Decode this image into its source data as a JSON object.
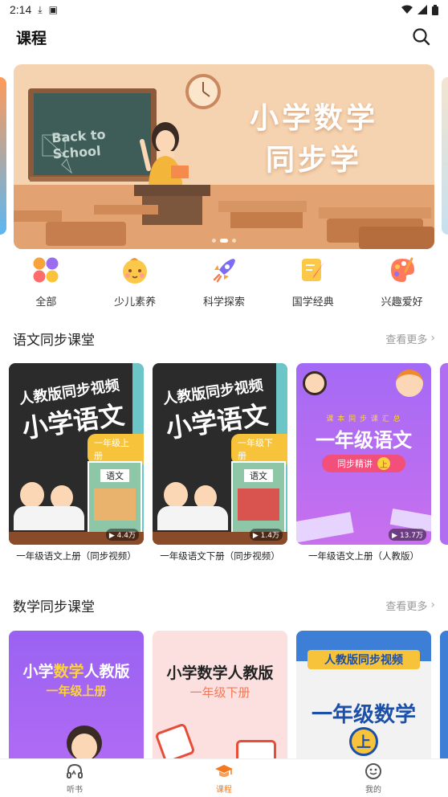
{
  "status_bar": {
    "time": "2:14"
  },
  "header": {
    "title": "课程"
  },
  "banner": {
    "title_line1": "小学数学",
    "title_line2": "同步学",
    "board_text1": "Back to",
    "board_text2": "School"
  },
  "categories": [
    {
      "label": "全部",
      "icon": "grid-icon"
    },
    {
      "label": "少儿素养",
      "icon": "baby-face-icon"
    },
    {
      "label": "科学探索",
      "icon": "rocket-icon"
    },
    {
      "label": "国学经典",
      "icon": "scroll-brush-icon"
    },
    {
      "label": "兴趣爱好",
      "icon": "palette-icon"
    }
  ],
  "chinese_section": {
    "title": "语文同步课堂",
    "more": "查看更多",
    "cards": [
      {
        "title": "一年级语文上册（同步视频）",
        "views": "▶ 4.4万",
        "head": "人教版同步视频",
        "big": "小学语文",
        "ribbon": "一年级上册",
        "book": "语文"
      },
      {
        "title": "一年级语文下册（同步视频）",
        "views": "▶ 1.4万",
        "head": "人教版同步视频",
        "big": "小学语文",
        "ribbon": "一年级下册",
        "book": "语文"
      },
      {
        "title": "一年级语文上册（人教版）",
        "views": "▶ 13.7万",
        "top": "课 本 同 步 课 汇 总",
        "big": "一年级语文",
        "pill": "同步精讲",
        "badge": "上"
      }
    ]
  },
  "math_section": {
    "title": "数学同步课堂",
    "more": "查看更多",
    "cards": [
      {
        "line1a": "小学",
        "line1b": "数学",
        "line1c": "人教版",
        "line2": "一年级上册"
      },
      {
        "line1": "小学数学人教版",
        "line2": "一年级下册"
      },
      {
        "line1": "人教版同步视频",
        "line2": "一年级数学",
        "badge": "上"
      }
    ]
  },
  "tabs": [
    {
      "label": "听书",
      "icon": "headphones-icon"
    },
    {
      "label": "课程",
      "icon": "graduation-cap-icon",
      "active": true
    },
    {
      "label": "我的",
      "icon": "smiley-face-icon"
    }
  ],
  "colors": {
    "accent": "#f47a1f"
  }
}
